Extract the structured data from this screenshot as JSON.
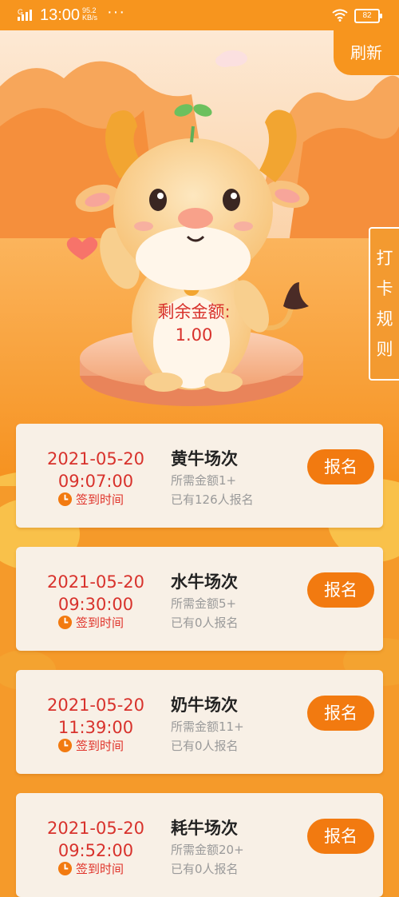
{
  "status": {
    "time": "13:00",
    "speed_top": "95.2",
    "speed_bottom": "KB/s",
    "dots": "···",
    "battery": "82",
    "network": "G"
  },
  "header": {
    "refresh_label": "刷新",
    "rules_chars": [
      "打",
      "卡",
      "规",
      "则"
    ]
  },
  "balance": {
    "label": "剩余金额:",
    "value": "1.00"
  },
  "sessions": [
    {
      "date": "2021-05-20",
      "time": "09:07:00",
      "checkin_label": "签到时间",
      "title": "黄牛场次",
      "need": "所需金额1+",
      "count": "已有126人报名",
      "button": "报名"
    },
    {
      "date": "2021-05-20",
      "time": "09:30:00",
      "checkin_label": "签到时间",
      "title": "水牛场次",
      "need": "所需金额5+",
      "count": "已有0人报名",
      "button": "报名"
    },
    {
      "date": "2021-05-20",
      "time": "11:39:00",
      "checkin_label": "签到时间",
      "title": "奶牛场次",
      "need": "所需金额11+",
      "count": "已有0人报名",
      "button": "报名"
    },
    {
      "date": "2021-05-20",
      "time": "09:52:00",
      "checkin_label": "签到时间",
      "title": "耗牛场次",
      "need": "所需金额20+",
      "count": "已有0人报名",
      "button": "报名"
    }
  ],
  "colors": {
    "accent": "#f7951e",
    "button": "#f27a10",
    "date_red": "#d8322c",
    "card_bg": "#f8f0e6"
  }
}
